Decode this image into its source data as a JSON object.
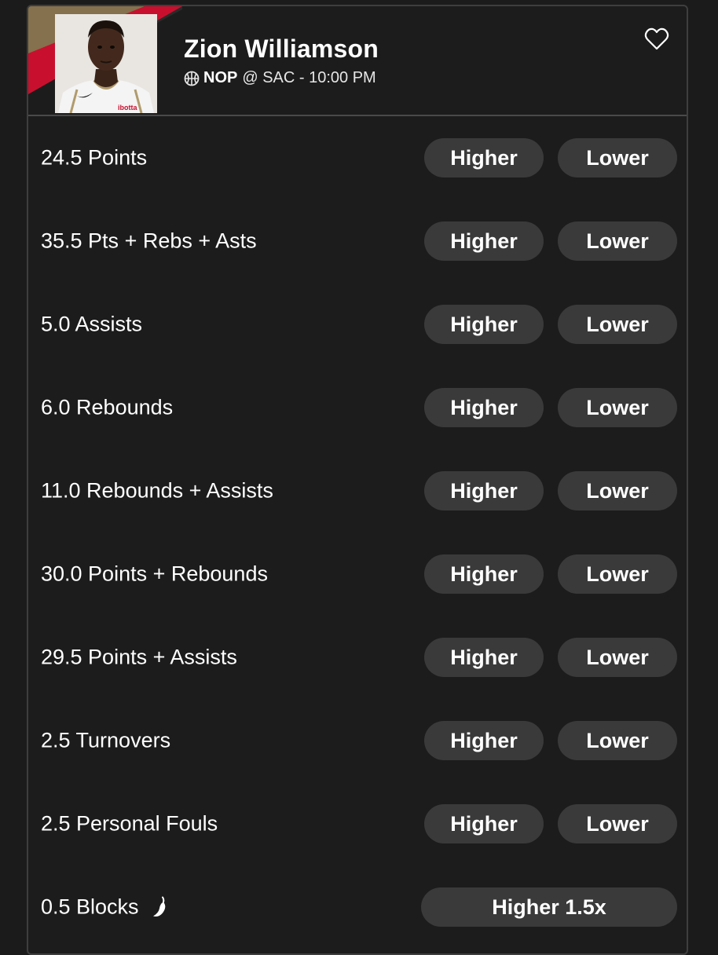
{
  "player": {
    "name": "Zion Williamson",
    "team": "NOP",
    "matchup": "@ SAC - 10:00 PM",
    "jersey_text": "ibotta"
  },
  "colors": {
    "background": "#1b1b1b",
    "button": "#3a3a3a",
    "team_red": "#c8102e",
    "team_gold": "#85714d"
  },
  "props": [
    {
      "label": "24.5 Points",
      "higher": "Higher",
      "lower": "Lower"
    },
    {
      "label": "35.5 Pts + Rebs + Asts",
      "higher": "Higher",
      "lower": "Lower"
    },
    {
      "label": "5.0 Assists",
      "higher": "Higher",
      "lower": "Lower"
    },
    {
      "label": "6.0 Rebounds",
      "higher": "Higher",
      "lower": "Lower"
    },
    {
      "label": "11.0 Rebounds + Assists",
      "higher": "Higher",
      "lower": "Lower"
    },
    {
      "label": "30.0 Points + Rebounds",
      "higher": "Higher",
      "lower": "Lower"
    },
    {
      "label": "29.5 Points + Assists",
      "higher": "Higher",
      "lower": "Lower"
    },
    {
      "label": "2.5 Turnovers",
      "higher": "Higher",
      "lower": "Lower"
    },
    {
      "label": "2.5 Personal Fouls",
      "higher": "Higher",
      "lower": "Lower"
    }
  ],
  "special_prop": {
    "label": "0.5 Blocks",
    "icon": "pepper-icon",
    "button": "Higher 1.5x"
  }
}
